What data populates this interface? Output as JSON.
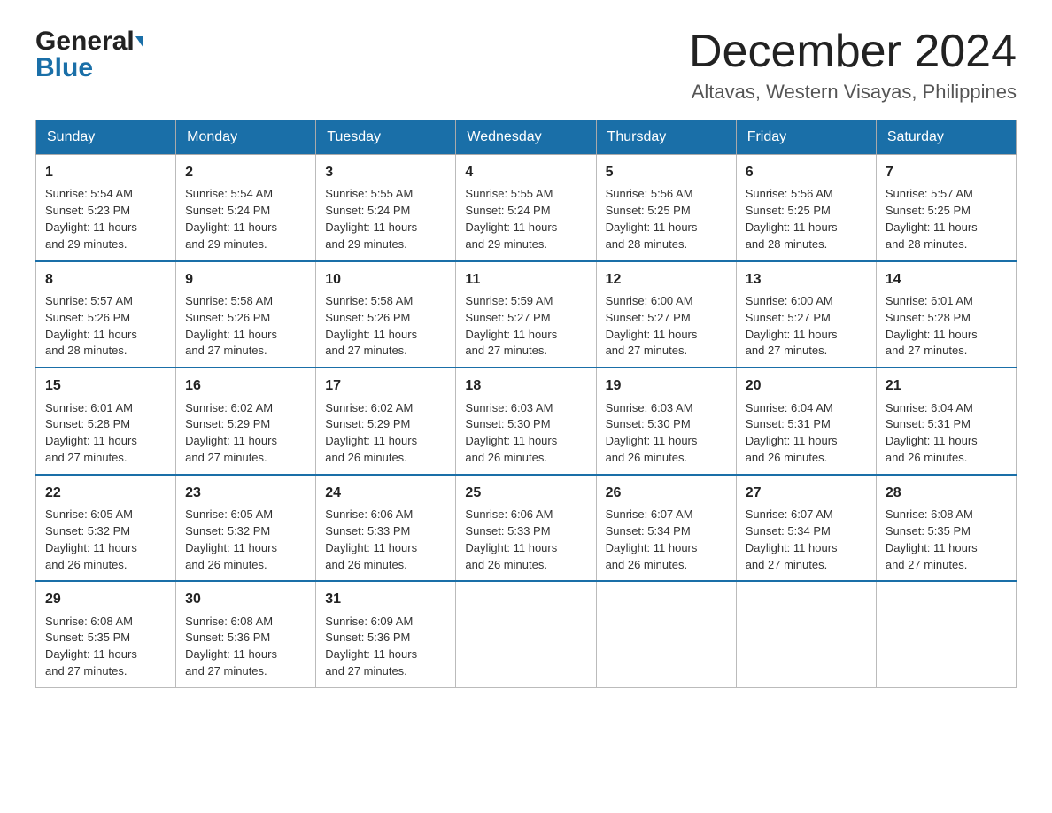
{
  "header": {
    "logo_line1": "General",
    "logo_line2": "Blue",
    "month_year": "December 2024",
    "location": "Altavas, Western Visayas, Philippines"
  },
  "weekdays": [
    "Sunday",
    "Monday",
    "Tuesday",
    "Wednesday",
    "Thursday",
    "Friday",
    "Saturday"
  ],
  "weeks": [
    [
      {
        "day": "1",
        "sunrise": "5:54 AM",
        "sunset": "5:23 PM",
        "daylight": "11 hours and 29 minutes."
      },
      {
        "day": "2",
        "sunrise": "5:54 AM",
        "sunset": "5:24 PM",
        "daylight": "11 hours and 29 minutes."
      },
      {
        "day": "3",
        "sunrise": "5:55 AM",
        "sunset": "5:24 PM",
        "daylight": "11 hours and 29 minutes."
      },
      {
        "day": "4",
        "sunrise": "5:55 AM",
        "sunset": "5:24 PM",
        "daylight": "11 hours and 29 minutes."
      },
      {
        "day": "5",
        "sunrise": "5:56 AM",
        "sunset": "5:25 PM",
        "daylight": "11 hours and 28 minutes."
      },
      {
        "day": "6",
        "sunrise": "5:56 AM",
        "sunset": "5:25 PM",
        "daylight": "11 hours and 28 minutes."
      },
      {
        "day": "7",
        "sunrise": "5:57 AM",
        "sunset": "5:25 PM",
        "daylight": "11 hours and 28 minutes."
      }
    ],
    [
      {
        "day": "8",
        "sunrise": "5:57 AM",
        "sunset": "5:26 PM",
        "daylight": "11 hours and 28 minutes."
      },
      {
        "day": "9",
        "sunrise": "5:58 AM",
        "sunset": "5:26 PM",
        "daylight": "11 hours and 27 minutes."
      },
      {
        "day": "10",
        "sunrise": "5:58 AM",
        "sunset": "5:26 PM",
        "daylight": "11 hours and 27 minutes."
      },
      {
        "day": "11",
        "sunrise": "5:59 AM",
        "sunset": "5:27 PM",
        "daylight": "11 hours and 27 minutes."
      },
      {
        "day": "12",
        "sunrise": "6:00 AM",
        "sunset": "5:27 PM",
        "daylight": "11 hours and 27 minutes."
      },
      {
        "day": "13",
        "sunrise": "6:00 AM",
        "sunset": "5:27 PM",
        "daylight": "11 hours and 27 minutes."
      },
      {
        "day": "14",
        "sunrise": "6:01 AM",
        "sunset": "5:28 PM",
        "daylight": "11 hours and 27 minutes."
      }
    ],
    [
      {
        "day": "15",
        "sunrise": "6:01 AM",
        "sunset": "5:28 PM",
        "daylight": "11 hours and 27 minutes."
      },
      {
        "day": "16",
        "sunrise": "6:02 AM",
        "sunset": "5:29 PM",
        "daylight": "11 hours and 27 minutes."
      },
      {
        "day": "17",
        "sunrise": "6:02 AM",
        "sunset": "5:29 PM",
        "daylight": "11 hours and 26 minutes."
      },
      {
        "day": "18",
        "sunrise": "6:03 AM",
        "sunset": "5:30 PM",
        "daylight": "11 hours and 26 minutes."
      },
      {
        "day": "19",
        "sunrise": "6:03 AM",
        "sunset": "5:30 PM",
        "daylight": "11 hours and 26 minutes."
      },
      {
        "day": "20",
        "sunrise": "6:04 AM",
        "sunset": "5:31 PM",
        "daylight": "11 hours and 26 minutes."
      },
      {
        "day": "21",
        "sunrise": "6:04 AM",
        "sunset": "5:31 PM",
        "daylight": "11 hours and 26 minutes."
      }
    ],
    [
      {
        "day": "22",
        "sunrise": "6:05 AM",
        "sunset": "5:32 PM",
        "daylight": "11 hours and 26 minutes."
      },
      {
        "day": "23",
        "sunrise": "6:05 AM",
        "sunset": "5:32 PM",
        "daylight": "11 hours and 26 minutes."
      },
      {
        "day": "24",
        "sunrise": "6:06 AM",
        "sunset": "5:33 PM",
        "daylight": "11 hours and 26 minutes."
      },
      {
        "day": "25",
        "sunrise": "6:06 AM",
        "sunset": "5:33 PM",
        "daylight": "11 hours and 26 minutes."
      },
      {
        "day": "26",
        "sunrise": "6:07 AM",
        "sunset": "5:34 PM",
        "daylight": "11 hours and 26 minutes."
      },
      {
        "day": "27",
        "sunrise": "6:07 AM",
        "sunset": "5:34 PM",
        "daylight": "11 hours and 27 minutes."
      },
      {
        "day": "28",
        "sunrise": "6:08 AM",
        "sunset": "5:35 PM",
        "daylight": "11 hours and 27 minutes."
      }
    ],
    [
      {
        "day": "29",
        "sunrise": "6:08 AM",
        "sunset": "5:35 PM",
        "daylight": "11 hours and 27 minutes."
      },
      {
        "day": "30",
        "sunrise": "6:08 AM",
        "sunset": "5:36 PM",
        "daylight": "11 hours and 27 minutes."
      },
      {
        "day": "31",
        "sunrise": "6:09 AM",
        "sunset": "5:36 PM",
        "daylight": "11 hours and 27 minutes."
      },
      null,
      null,
      null,
      null
    ]
  ],
  "labels": {
    "sunrise": "Sunrise:",
    "sunset": "Sunset:",
    "daylight": "Daylight:"
  }
}
